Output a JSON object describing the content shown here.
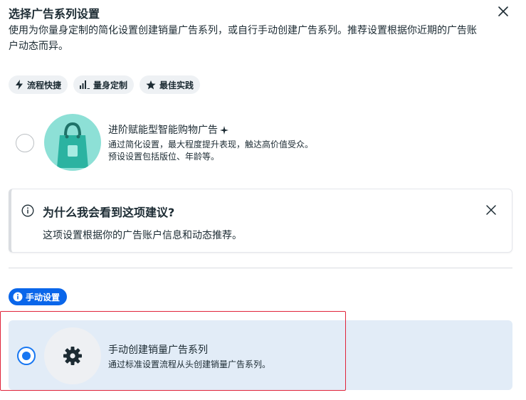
{
  "dialog": {
    "title": "选择广告系列设置",
    "subtitle": "使用为你量身定制的简化设置创建销量广告系列，或自行手动创建广告系列。推荐设置根据你近期的广告账户动态而异。"
  },
  "tags": [
    {
      "label": "流程快捷",
      "icon": "lightning-icon"
    },
    {
      "label": "量身定制",
      "icon": "bar-chart-icon"
    },
    {
      "label": "最佳实践",
      "icon": "star-icon"
    }
  ],
  "auto_option": {
    "title": "进阶赋能型智能购物广告",
    "desc_line1": "通过简化设置，最大程度提升表现，触达高价值受众。",
    "desc_line2": "预设设置包括版位、年龄等。",
    "selected": false
  },
  "info_box": {
    "title": "为什么我会看到这项建议?",
    "text": "这项设置根据你的广告账户信息和动态推荐。"
  },
  "manual_section": {
    "badge": "手动设置"
  },
  "manual_option": {
    "title": "手动创建销量广告系列",
    "desc": "通过标准设置流程从头创建销量广告系列。",
    "selected": true
  },
  "colors": {
    "accent": "#1877f2",
    "badge": "#0a66ea",
    "selected_bg": "#e2ecf7",
    "bag_bg": "#8de0d6",
    "highlight": "#e0243a"
  }
}
